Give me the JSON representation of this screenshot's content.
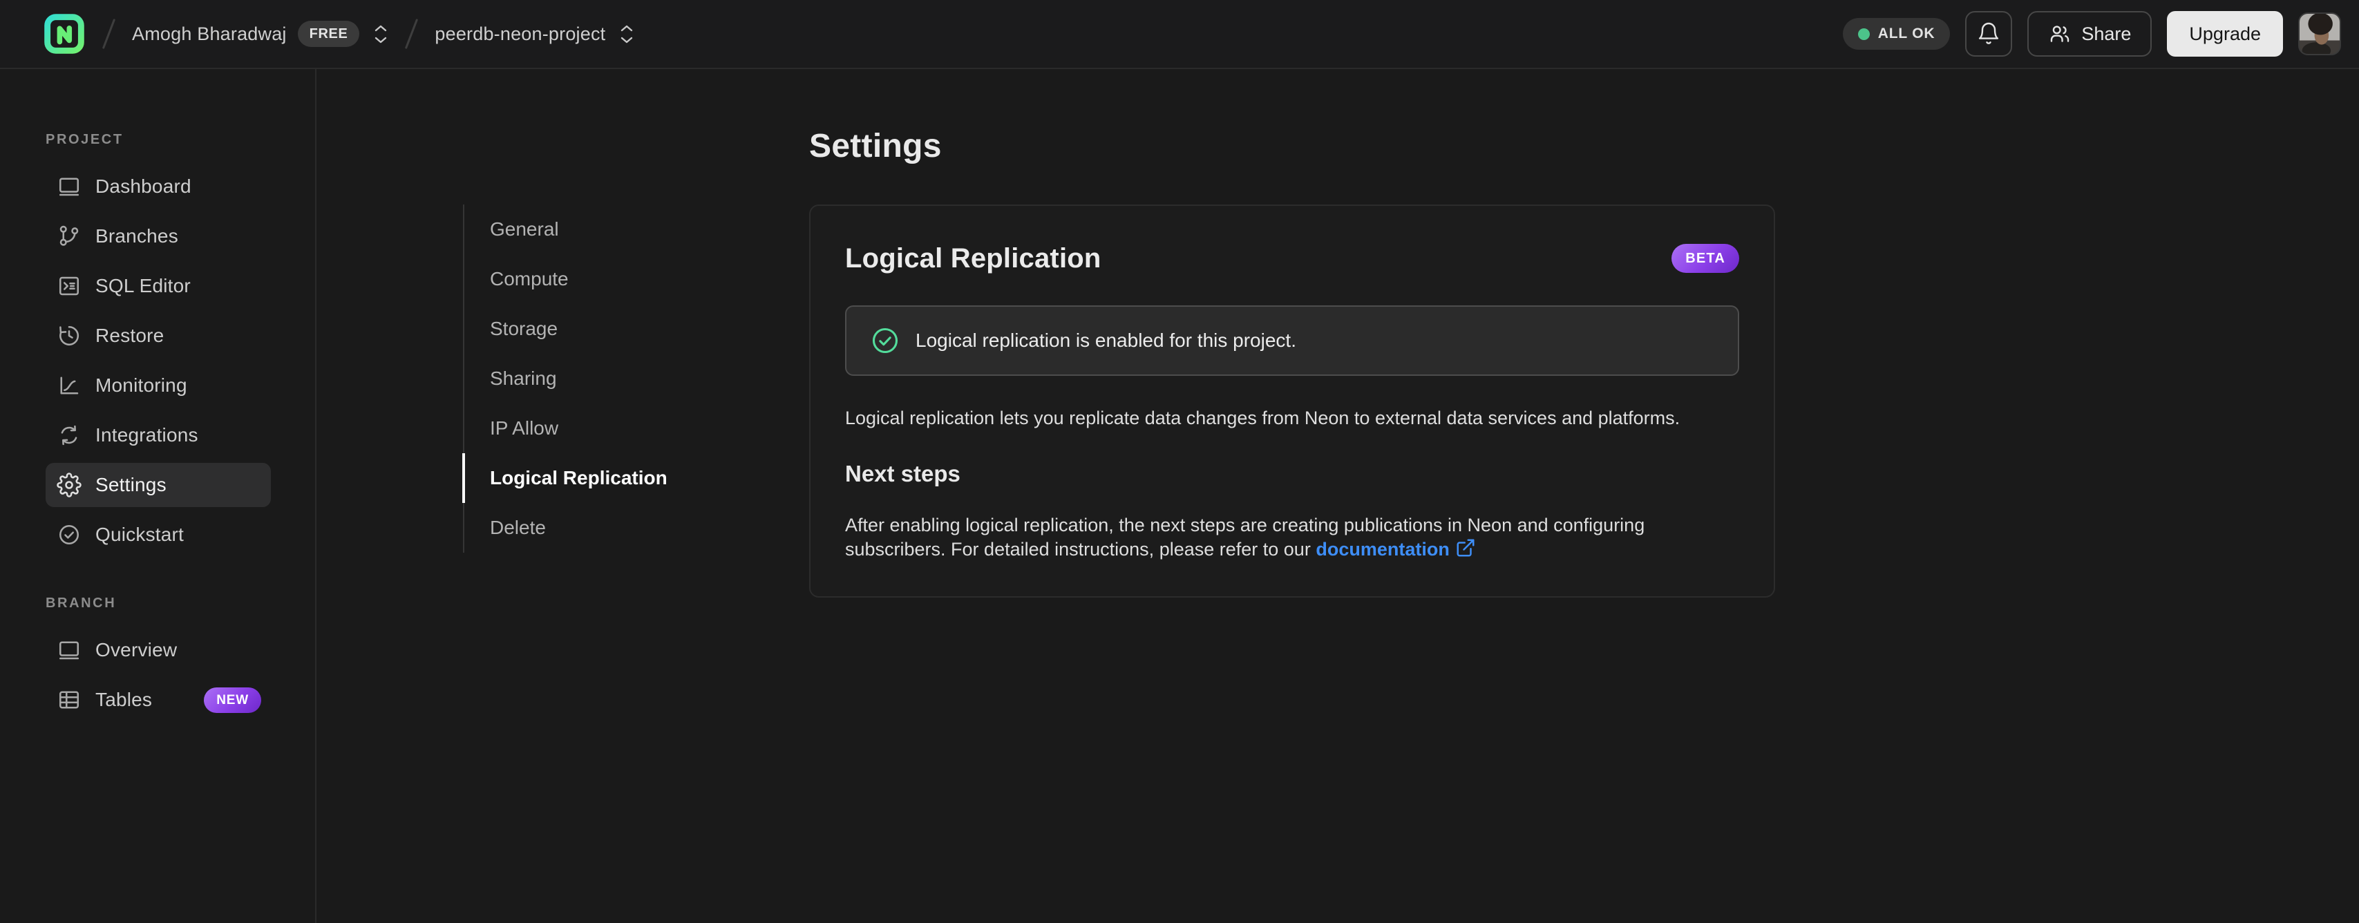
{
  "header": {
    "breadcrumb": {
      "org_name": "Amogh Bharadwaj",
      "org_plan_badge": "FREE",
      "project_name": "peerdb-neon-project"
    },
    "status_badge": "ALL OK",
    "buttons": {
      "share": "Share",
      "upgrade": "Upgrade"
    }
  },
  "sidebar": {
    "sections": [
      {
        "label": "PROJECT",
        "items": [
          {
            "label": "Dashboard",
            "icon": "dashboard-icon"
          },
          {
            "label": "Branches",
            "icon": "git-branch-icon"
          },
          {
            "label": "SQL Editor",
            "icon": "sql-terminal-icon"
          },
          {
            "label": "Restore",
            "icon": "history-clock-icon"
          },
          {
            "label": "Monitoring",
            "icon": "chart-line-icon"
          },
          {
            "label": "Integrations",
            "icon": "integrations-cycle-icon"
          },
          {
            "label": "Settings",
            "icon": "gear-icon",
            "active": true
          },
          {
            "label": "Quickstart",
            "icon": "check-circle-icon"
          }
        ]
      },
      {
        "label": "BRANCH",
        "items": [
          {
            "label": "Overview",
            "icon": "window-icon"
          },
          {
            "label": "Tables",
            "icon": "table-icon",
            "badge": "NEW"
          }
        ]
      }
    ]
  },
  "settings_nav": {
    "items": [
      {
        "label": "General"
      },
      {
        "label": "Compute"
      },
      {
        "label": "Storage"
      },
      {
        "label": "Sharing"
      },
      {
        "label": "IP Allow"
      },
      {
        "label": "Logical Replication",
        "active": true
      },
      {
        "label": "Delete"
      }
    ]
  },
  "main": {
    "page_title": "Settings",
    "card": {
      "title": "Logical Replication",
      "beta_badge": "BETA",
      "alert_text": "Logical replication is enabled for this project.",
      "description": "Logical replication lets you replicate data changes from Neon to external data services and platforms.",
      "next_steps_title": "Next steps",
      "next_steps_text": "After enabling logical replication, the next steps are creating publications in Neon and configuring subscribers. For detailed instructions, please refer to our ",
      "doc_link_label": "documentation"
    }
  },
  "colors": {
    "status_ok_green": "#4cc38a",
    "success_icon_green": "#53dc9b",
    "badge_purple_from": "#ab70f5",
    "badge_purple_to": "#6d28c9",
    "link_blue": "#3e8ef7",
    "logo_gradient_from": "#34dfd0",
    "logo_gradient_to": "#71f170"
  }
}
